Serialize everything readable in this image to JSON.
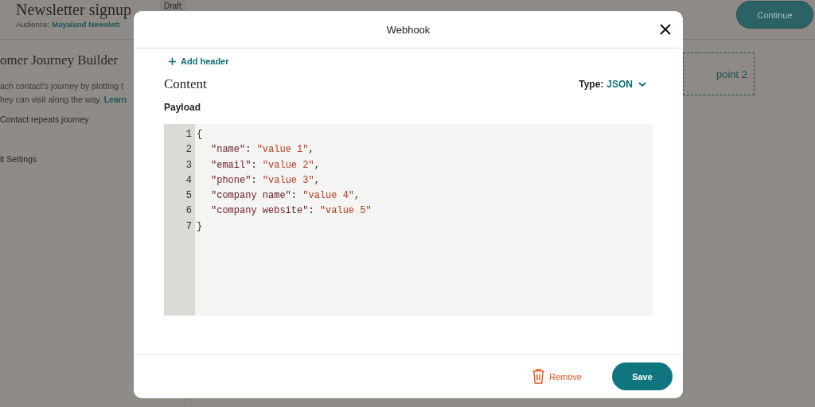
{
  "page": {
    "title": "Newsletter signup",
    "status_badge": "Draft",
    "audience_label": "Audience:",
    "audience_value": "Mayaland Newslett",
    "continue_button": "Continue"
  },
  "sidebar": {
    "heading": "omer Journey Builder",
    "description_lines": [
      "ach contact's journey by plotting t",
      "hey can visit along the way."
    ],
    "learn_link": "Learn",
    "items": [
      "Contact repeats journey",
      "it Settings"
    ]
  },
  "canvas": {
    "node_label": "point 2"
  },
  "modal": {
    "title": "Webhook",
    "add_header": "Add header",
    "section_title": "Content",
    "type_label": "Type:",
    "type_value": "JSON",
    "payload_label": "Payload",
    "lines": [
      {
        "number": "1",
        "indented": false,
        "parts": [
          {
            "kind": "punct",
            "text": "{"
          }
        ]
      },
      {
        "number": "2",
        "indented": true,
        "parts": [
          {
            "kind": "key",
            "text": "\"name\""
          },
          {
            "kind": "punct",
            "text": ": "
          },
          {
            "kind": "string",
            "text": "\"value 1\""
          },
          {
            "kind": "punct",
            "text": ","
          }
        ]
      },
      {
        "number": "3",
        "indented": true,
        "parts": [
          {
            "kind": "key",
            "text": "\"email\""
          },
          {
            "kind": "punct",
            "text": ": "
          },
          {
            "kind": "string",
            "text": "\"value 2\""
          },
          {
            "kind": "punct",
            "text": ","
          }
        ]
      },
      {
        "number": "4",
        "indented": true,
        "parts": [
          {
            "kind": "key",
            "text": "\"phone\""
          },
          {
            "kind": "punct",
            "text": ": "
          },
          {
            "kind": "string",
            "text": "\"value 3\""
          },
          {
            "kind": "punct",
            "text": ","
          }
        ]
      },
      {
        "number": "5",
        "indented": true,
        "parts": [
          {
            "kind": "key",
            "text": "\"company name\""
          },
          {
            "kind": "punct",
            "text": ": "
          },
          {
            "kind": "string",
            "text": "\"value 4\""
          },
          {
            "kind": "punct",
            "text": ","
          }
        ]
      },
      {
        "number": "6",
        "indented": true,
        "parts": [
          {
            "kind": "key",
            "text": "\"company website\""
          },
          {
            "kind": "punct",
            "text": ": "
          },
          {
            "kind": "string",
            "text": "\"value 5\""
          }
        ]
      },
      {
        "number": "7",
        "indented": false,
        "parts": [
          {
            "kind": "punct",
            "text": "}"
          }
        ]
      }
    ],
    "remove_button": "Remove",
    "save_button": "Save"
  }
}
